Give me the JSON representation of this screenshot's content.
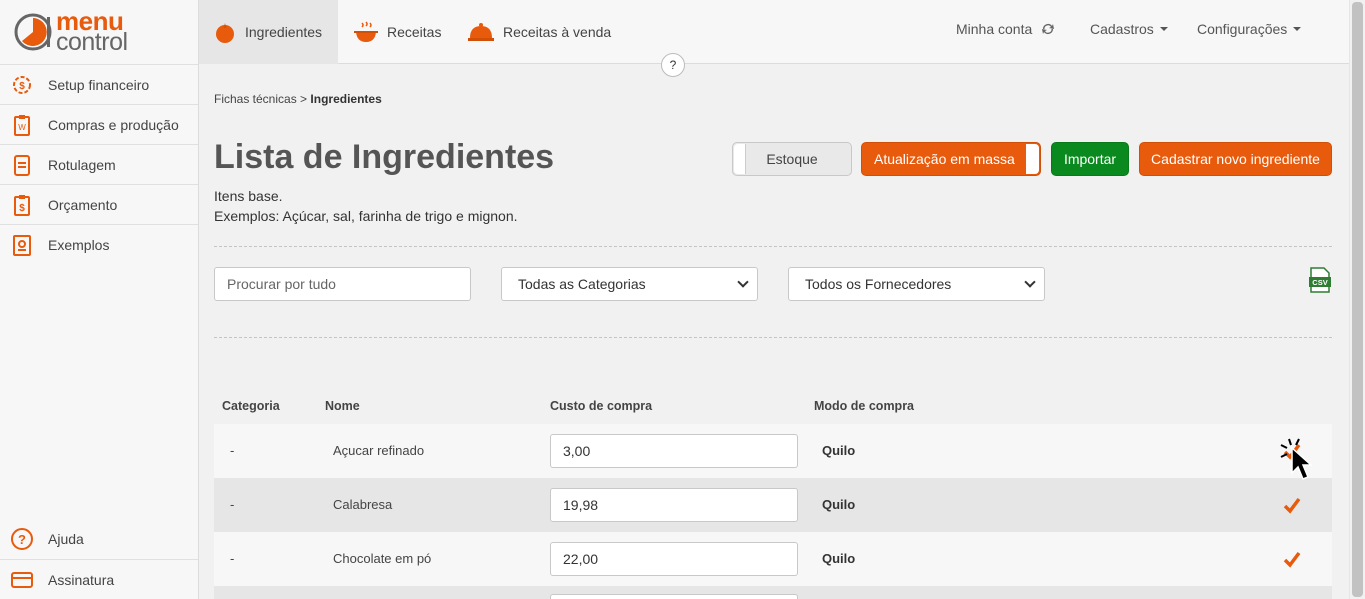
{
  "app": {
    "logo_line1": "menu",
    "logo_line2": "control",
    "brand_color": "#e85a0c",
    "green_color": "#0a8a1e"
  },
  "sidebar": {
    "items": [
      {
        "label": "Setup financeiro",
        "icon": "gear-dollar-icon"
      },
      {
        "label": "Compras e produção",
        "icon": "clipboard-icon"
      },
      {
        "label": "Rotulagem",
        "icon": "label-icon"
      },
      {
        "label": "Orçamento",
        "icon": "budget-icon"
      },
      {
        "label": "Exemplos",
        "icon": "book-icon"
      }
    ],
    "bottom_items": [
      {
        "label": "Ajuda",
        "icon": "help-icon"
      },
      {
        "label": "Assinatura",
        "icon": "card-icon"
      }
    ]
  },
  "topbar": {
    "tabs": [
      {
        "label": "Ingredientes",
        "icon": "tomato-icon"
      },
      {
        "label": "Receitas",
        "icon": "pot-icon"
      },
      {
        "label": "Receitas à venda",
        "icon": "cloche-icon"
      }
    ],
    "account_label": "Minha conta",
    "registers_label": "Cadastros",
    "settings_label": "Configurações",
    "help_label": "?"
  },
  "page": {
    "breadcrumb_parent": "Fichas técnicas",
    "breadcrumb_sep": ">",
    "breadcrumb_current": "Ingredientes",
    "title": "Lista de Ingredientes",
    "desc_line1": "Itens base.",
    "desc_line2": "Exemplos: Açúcar, sal, farinha de trigo e mignon.",
    "btn_stock": "Estoque",
    "btn_mass_update": "Atualização em massa",
    "btn_import": "Importar",
    "btn_new": "Cadastrar novo ingrediente"
  },
  "filters": {
    "search_placeholder": "Procurar por tudo",
    "category_selected": "Todas as Categorias",
    "supplier_selected": "Todos os Fornecedores",
    "csv_label": "CSV"
  },
  "table": {
    "headers": {
      "category": "Categoria",
      "name": "Nome",
      "cost": "Custo de compra",
      "mode": "Modo de compra"
    },
    "rows": [
      {
        "category": "-",
        "name": "Açucar refinado",
        "cost": "3,00",
        "mode": "Quilo"
      },
      {
        "category": "-",
        "name": "Calabresa",
        "cost": "19,98",
        "mode": "Quilo"
      },
      {
        "category": "-",
        "name": "Chocolate em pó",
        "cost": "22,00",
        "mode": "Quilo"
      }
    ]
  }
}
